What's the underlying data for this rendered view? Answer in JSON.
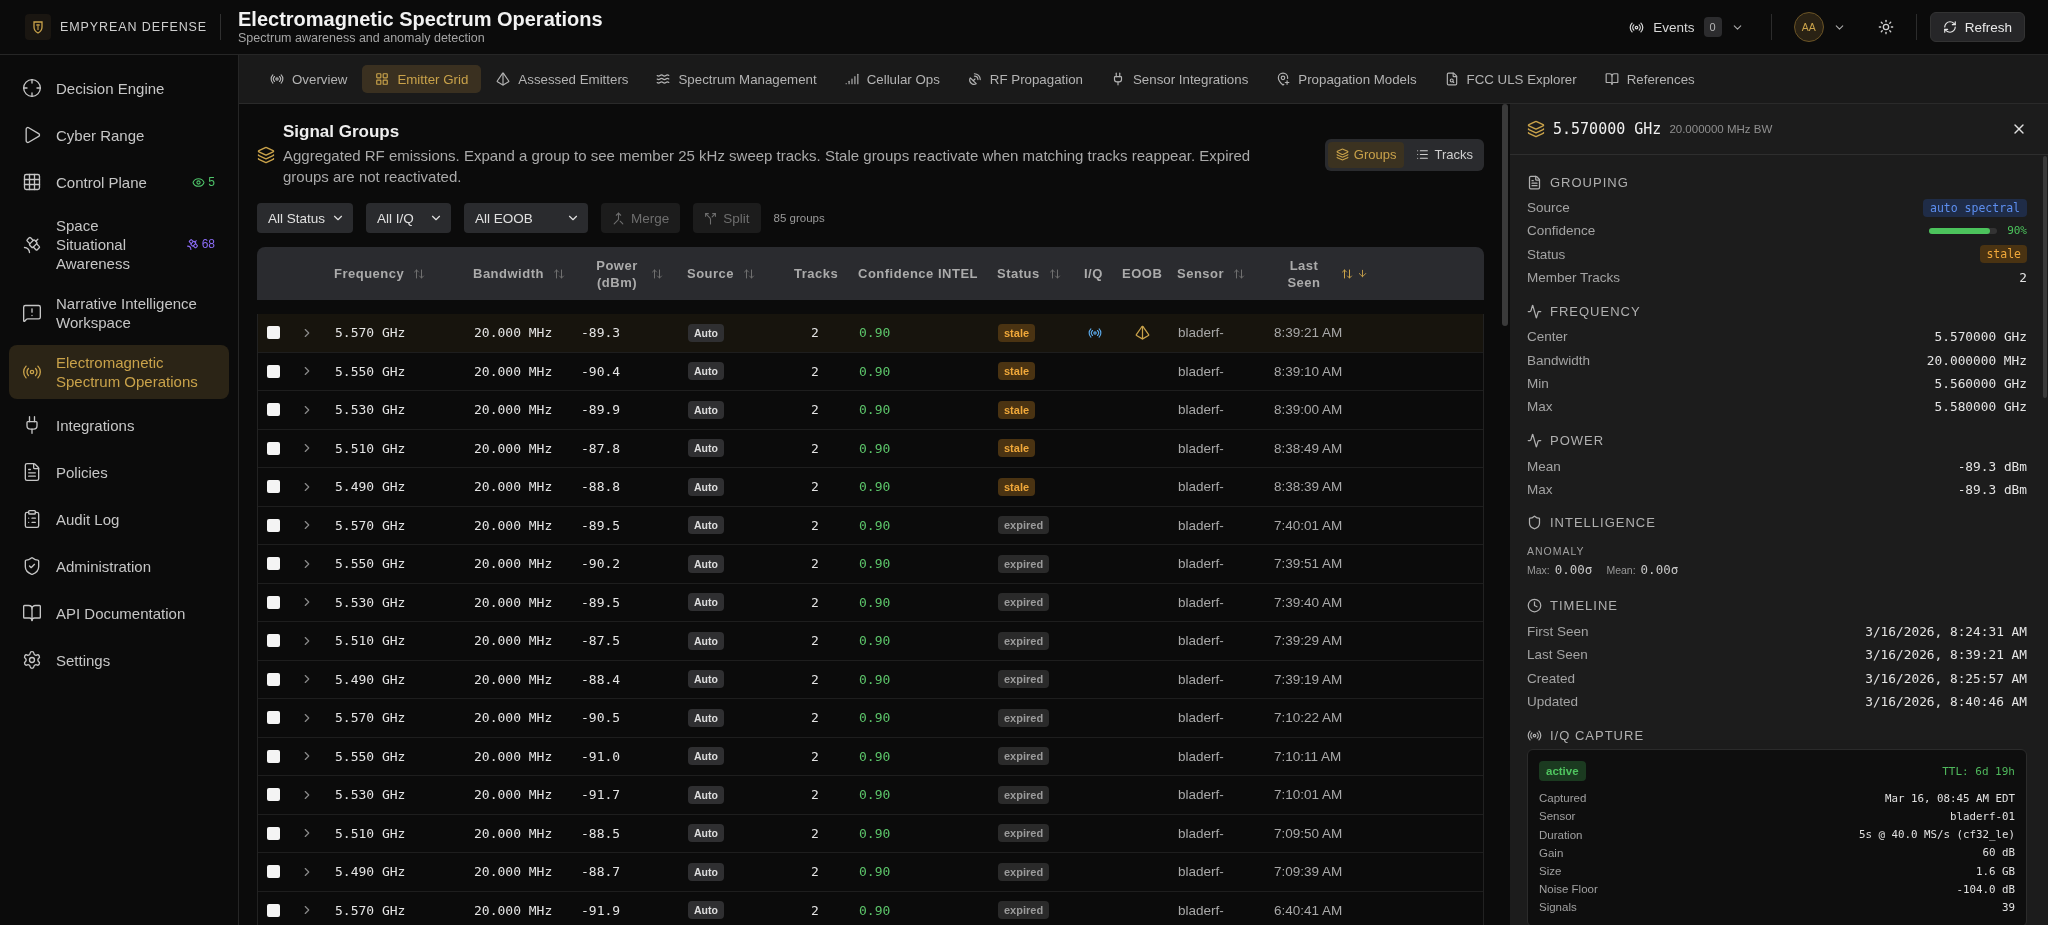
{
  "brand": {
    "name": "EMPYREAN DEFENSE"
  },
  "page": {
    "title": "Electromagnetic Spectrum Operations",
    "subtitle": "Spectrum awareness and anomaly detection"
  },
  "top_bar": {
    "events": {
      "label": "Events",
      "count": "0"
    },
    "user": {
      "initials": "AA"
    },
    "refresh": {
      "label": "Refresh"
    }
  },
  "sidebar": {
    "items": [
      {
        "label": "Decision Engine",
        "selected": false
      },
      {
        "label": "Cyber Range",
        "selected": false
      },
      {
        "label": "Control Plane",
        "selected": false,
        "badge": {
          "text": "5",
          "color": "#4ec46a"
        }
      },
      {
        "label": "Space Situational Awareness",
        "selected": false,
        "badge": {
          "text": "68",
          "color": "#8b6cf6"
        }
      },
      {
        "label": "Narrative Intelligence Workspace",
        "selected": false
      },
      {
        "label": "Electromagnetic Spectrum Operations",
        "selected": true
      },
      {
        "label": "Integrations",
        "selected": false
      },
      {
        "label": "Policies",
        "selected": false
      },
      {
        "label": "Audit Log",
        "selected": false
      },
      {
        "label": "Administration",
        "selected": false
      },
      {
        "label": "API Documentation",
        "selected": false
      },
      {
        "label": "Settings",
        "selected": false
      }
    ]
  },
  "tabs": [
    {
      "label": "Overview",
      "selected": false
    },
    {
      "label": "Emitter Grid",
      "selected": true
    },
    {
      "label": "Assessed Emitters",
      "selected": false
    },
    {
      "label": "Spectrum Management",
      "selected": false
    },
    {
      "label": "Cellular Ops",
      "selected": false
    },
    {
      "label": "RF Propagation",
      "selected": false
    },
    {
      "label": "Sensor Integrations",
      "selected": false
    },
    {
      "label": "Propagation Models",
      "selected": false
    },
    {
      "label": "FCC ULS Explorer",
      "selected": false
    },
    {
      "label": "References",
      "selected": false
    }
  ],
  "signal_groups": {
    "title": "Signal Groups",
    "description": "Aggregated RF emissions. Expand a group to see member 25 kHz sweep tracks. Stale groups reactivate when matching tracks reappear. Expired groups are not reactivated.",
    "view_toggle": [
      {
        "label": "Groups",
        "selected": true
      },
      {
        "label": "Tracks",
        "selected": false
      }
    ],
    "filters": [
      {
        "value": "All Status"
      },
      {
        "value": "All I/Q"
      },
      {
        "value": "All EOOB"
      }
    ],
    "actions": [
      {
        "label": "Merge",
        "disabled": true
      },
      {
        "label": "Split",
        "disabled": true
      }
    ],
    "count": "85 groups"
  },
  "table": {
    "columns": [
      {
        "label": "Frequency",
        "sortable": true,
        "sorted": false
      },
      {
        "label": "Bandwidth",
        "sortable": true,
        "sorted": false
      },
      {
        "label": "Power (dBm)",
        "sortable": true,
        "sorted": false
      },
      {
        "label": "Source",
        "sortable": true,
        "sorted": false
      },
      {
        "label": "Tracks",
        "sortable": false,
        "sorted": false
      },
      {
        "label": "Confidence",
        "sortable": false,
        "sorted": false
      },
      {
        "label": "INTEL",
        "sortable": false,
        "sorted": false
      },
      {
        "label": "Status",
        "sortable": true,
        "sorted": false
      },
      {
        "label": "I/Q",
        "sortable": false,
        "sorted": false
      },
      {
        "label": "EOOB",
        "sortable": false,
        "sorted": false
      },
      {
        "label": "Sensor",
        "sortable": true,
        "sorted": false
      },
      {
        "label": "Last Seen",
        "sortable": true,
        "sorted": true
      }
    ],
    "rows": [
      {
        "checked": false,
        "expanded": false,
        "selected": true,
        "frequency": "5.570 GHz",
        "bandwidth": "20.000 MHz",
        "power": "-89.3",
        "source": "Auto",
        "tracks": "2",
        "confidence": "0.90",
        "status": {
          "text": "stale",
          "kind": "warning"
        },
        "iq": true,
        "eoob": true,
        "sensor": "bladerf-",
        "last_seen": "8:39:21 AM"
      },
      {
        "checked": false,
        "expanded": false,
        "selected": false,
        "frequency": "5.550 GHz",
        "bandwidth": "20.000 MHz",
        "power": "-90.4",
        "source": "Auto",
        "tracks": "2",
        "confidence": "0.90",
        "status": {
          "text": "stale",
          "kind": "warning"
        },
        "iq": false,
        "eoob": false,
        "sensor": "bladerf-",
        "last_seen": "8:39:10 AM"
      },
      {
        "checked": false,
        "expanded": false,
        "selected": false,
        "frequency": "5.530 GHz",
        "bandwidth": "20.000 MHz",
        "power": "-89.9",
        "source": "Auto",
        "tracks": "2",
        "confidence": "0.90",
        "status": {
          "text": "stale",
          "kind": "warning"
        },
        "iq": false,
        "eoob": false,
        "sensor": "bladerf-",
        "last_seen": "8:39:00 AM"
      },
      {
        "checked": false,
        "expanded": false,
        "selected": false,
        "frequency": "5.510 GHz",
        "bandwidth": "20.000 MHz",
        "power": "-87.8",
        "source": "Auto",
        "tracks": "2",
        "confidence": "0.90",
        "status": {
          "text": "stale",
          "kind": "warning"
        },
        "iq": false,
        "eoob": false,
        "sensor": "bladerf-",
        "last_seen": "8:38:49 AM"
      },
      {
        "checked": false,
        "expanded": false,
        "selected": false,
        "frequency": "5.490 GHz",
        "bandwidth": "20.000 MHz",
        "power": "-88.8",
        "source": "Auto",
        "tracks": "2",
        "confidence": "0.90",
        "status": {
          "text": "stale",
          "kind": "warning"
        },
        "iq": false,
        "eoob": false,
        "sensor": "bladerf-",
        "last_seen": "8:38:39 AM"
      },
      {
        "checked": false,
        "expanded": false,
        "selected": false,
        "frequency": "5.570 GHz",
        "bandwidth": "20.000 MHz",
        "power": "-89.5",
        "source": "Auto",
        "tracks": "2",
        "confidence": "0.90",
        "status": {
          "text": "expired",
          "kind": "muted"
        },
        "iq": false,
        "eoob": false,
        "sensor": "bladerf-",
        "last_seen": "7:40:01 AM"
      },
      {
        "checked": false,
        "expanded": false,
        "selected": false,
        "frequency": "5.550 GHz",
        "bandwidth": "20.000 MHz",
        "power": "-90.2",
        "source": "Auto",
        "tracks": "2",
        "confidence": "0.90",
        "status": {
          "text": "expired",
          "kind": "muted"
        },
        "iq": false,
        "eoob": false,
        "sensor": "bladerf-",
        "last_seen": "7:39:51 AM"
      },
      {
        "checked": false,
        "expanded": false,
        "selected": false,
        "frequency": "5.530 GHz",
        "bandwidth": "20.000 MHz",
        "power": "-89.5",
        "source": "Auto",
        "tracks": "2",
        "confidence": "0.90",
        "status": {
          "text": "expired",
          "kind": "muted"
        },
        "iq": false,
        "eoob": false,
        "sensor": "bladerf-",
        "last_seen": "7:39:40 AM"
      },
      {
        "checked": false,
        "expanded": false,
        "selected": false,
        "frequency": "5.510 GHz",
        "bandwidth": "20.000 MHz",
        "power": "-87.5",
        "source": "Auto",
        "tracks": "2",
        "confidence": "0.90",
        "status": {
          "text": "expired",
          "kind": "muted"
        },
        "iq": false,
        "eoob": false,
        "sensor": "bladerf-",
        "last_seen": "7:39:29 AM"
      },
      {
        "checked": false,
        "expanded": false,
        "selected": false,
        "frequency": "5.490 GHz",
        "bandwidth": "20.000 MHz",
        "power": "-88.4",
        "source": "Auto",
        "tracks": "2",
        "confidence": "0.90",
        "status": {
          "text": "expired",
          "kind": "muted"
        },
        "iq": false,
        "eoob": false,
        "sensor": "bladerf-",
        "last_seen": "7:39:19 AM"
      },
      {
        "checked": false,
        "expanded": false,
        "selected": false,
        "frequency": "5.570 GHz",
        "bandwidth": "20.000 MHz",
        "power": "-90.5",
        "source": "Auto",
        "tracks": "2",
        "confidence": "0.90",
        "status": {
          "text": "expired",
          "kind": "muted"
        },
        "iq": false,
        "eoob": false,
        "sensor": "bladerf-",
        "last_seen": "7:10:22 AM"
      },
      {
        "checked": false,
        "expanded": false,
        "selected": false,
        "frequency": "5.550 GHz",
        "bandwidth": "20.000 MHz",
        "power": "-91.0",
        "source": "Auto",
        "tracks": "2",
        "confidence": "0.90",
        "status": {
          "text": "expired",
          "kind": "muted"
        },
        "iq": false,
        "eoob": false,
        "sensor": "bladerf-",
        "last_seen": "7:10:11 AM"
      },
      {
        "checked": false,
        "expanded": false,
        "selected": false,
        "frequency": "5.530 GHz",
        "bandwidth": "20.000 MHz",
        "power": "-91.7",
        "source": "Auto",
        "tracks": "2",
        "confidence": "0.90",
        "status": {
          "text": "expired",
          "kind": "muted"
        },
        "iq": false,
        "eoob": false,
        "sensor": "bladerf-",
        "last_seen": "7:10:01 AM"
      },
      {
        "checked": false,
        "expanded": false,
        "selected": false,
        "frequency": "5.510 GHz",
        "bandwidth": "20.000 MHz",
        "power": "-88.5",
        "source": "Auto",
        "tracks": "2",
        "confidence": "0.90",
        "status": {
          "text": "expired",
          "kind": "muted"
        },
        "iq": false,
        "eoob": false,
        "sensor": "bladerf-",
        "last_seen": "7:09:50 AM"
      },
      {
        "checked": false,
        "expanded": false,
        "selected": false,
        "frequency": "5.490 GHz",
        "bandwidth": "20.000 MHz",
        "power": "-88.7",
        "source": "Auto",
        "tracks": "2",
        "confidence": "0.90",
        "status": {
          "text": "expired",
          "kind": "muted"
        },
        "iq": false,
        "eoob": false,
        "sensor": "bladerf-",
        "last_seen": "7:09:39 AM"
      },
      {
        "checked": false,
        "expanded": false,
        "selected": false,
        "frequency": "5.570 GHz",
        "bandwidth": "20.000 MHz",
        "power": "-91.9",
        "source": "Auto",
        "tracks": "2",
        "confidence": "0.90",
        "status": {
          "text": "expired",
          "kind": "muted"
        },
        "iq": false,
        "eoob": false,
        "sensor": "bladerf-",
        "last_seen": "6:40:41 AM"
      }
    ]
  },
  "detail": {
    "title": "5.570000 GHz",
    "subtitle": "20.000000 MHz BW",
    "sections": [
      {
        "kind": "rows",
        "title": "GROUPING",
        "rows": [
          {
            "label": "Source",
            "kind": "tag",
            "value": "auto spectral"
          },
          {
            "label": "Confidence",
            "kind": "meter",
            "level": 0.9,
            "value": "90%"
          },
          {
            "label": "Status",
            "kind": "status",
            "status": {
              "text": "stale",
              "kind": "warning"
            }
          },
          {
            "label": "Member Tracks",
            "kind": "text",
            "value": "2"
          }
        ]
      },
      {
        "kind": "rows",
        "title": "FREQUENCY",
        "rows": [
          {
            "label": "Center",
            "kind": "text",
            "value": "5.570000 GHz"
          },
          {
            "label": "Bandwidth",
            "kind": "text",
            "value": "20.000000 MHz"
          },
          {
            "label": "Min",
            "kind": "text",
            "value": "5.560000 GHz"
          },
          {
            "label": "Max",
            "kind": "text",
            "value": "5.580000 GHz"
          }
        ]
      },
      {
        "kind": "rows",
        "title": "POWER",
        "rows": [
          {
            "label": "Mean",
            "kind": "text",
            "value": "-89.3 dBm"
          },
          {
            "label": "Max",
            "kind": "text",
            "value": "-89.3 dBm"
          }
        ]
      },
      {
        "kind": "anomaly",
        "title": "INTELLIGENCE",
        "label": "ANOMALY",
        "items": [
          {
            "label": "Max:",
            "value": "0.00σ"
          },
          {
            "label": "Mean:",
            "value": "0.00σ"
          }
        ]
      },
      {
        "kind": "rows",
        "title": "TIMELINE",
        "rows": [
          {
            "label": "First Seen",
            "kind": "text",
            "value": "3/16/2026, 8:24:31 AM"
          },
          {
            "label": "Last Seen",
            "kind": "text",
            "value": "3/16/2026, 8:39:21 AM"
          },
          {
            "label": "Created",
            "kind": "text",
            "value": "3/16/2026, 8:25:57 AM"
          },
          {
            "label": "Updated",
            "kind": "text",
            "value": "3/16/2026, 8:40:46 AM"
          }
        ]
      },
      {
        "kind": "capture",
        "title": "I/Q CAPTURE",
        "status": "active",
        "ttl": "TTL: 6d 19h",
        "rows": [
          {
            "label": "Captured",
            "value": "Mar 16, 08:45 AM EDT"
          },
          {
            "label": "Sensor",
            "value": "bladerf-01"
          },
          {
            "label": "Duration",
            "value": "5s @ 40.0 MS/s (cf32_le)"
          },
          {
            "label": "Gain",
            "value": "60 dB"
          },
          {
            "label": "Size",
            "value": "1.6 GB"
          },
          {
            "label": "Noise Floor",
            "value": "-104.0 dB"
          },
          {
            "label": "Signals",
            "value": "39"
          }
        ]
      }
    ]
  }
}
